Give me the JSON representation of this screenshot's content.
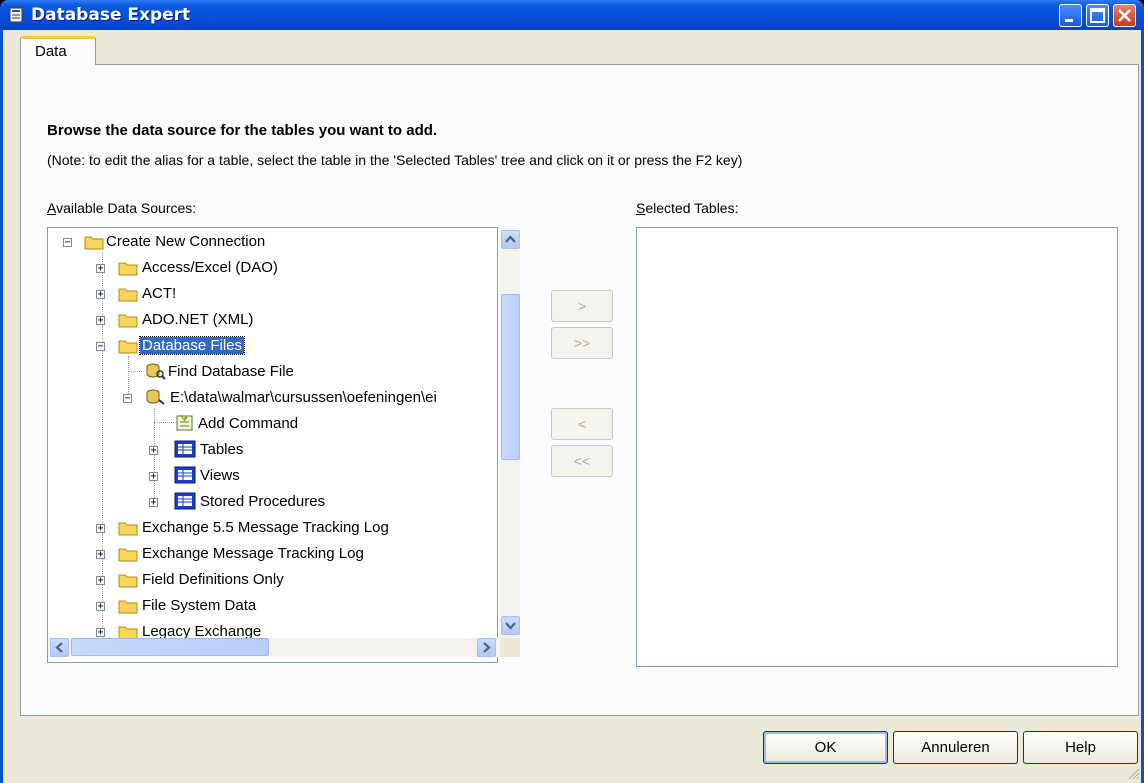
{
  "window": {
    "title": "Database Expert"
  },
  "tabs": [
    {
      "label": "Data",
      "active": true
    }
  ],
  "content": {
    "heading": "Browse the data source for the tables you want to add.",
    "note": "(Note: to edit the alias for a table, select the table in the 'Selected Tables' tree and click on it or press the F2 key)",
    "available_label_underlined": "A",
    "available_label_rest": "vailable Data Sources:",
    "selected_label_underlined": "S",
    "selected_label_rest": "elected Tables:"
  },
  "tree": {
    "items": [
      {
        "label": "Create New Connection",
        "icon": "folder-icon",
        "expanded": true
      },
      {
        "label": "Access/Excel (DAO)",
        "icon": "folder-icon",
        "expanded": false
      },
      {
        "label": "ACT!",
        "icon": "folder-icon",
        "expanded": false
      },
      {
        "label": "ADO.NET (XML)",
        "icon": "folder-icon",
        "expanded": false
      },
      {
        "label": "Database Files",
        "icon": "folder-icon",
        "expanded": true,
        "selected": true
      },
      {
        "label": "Find Database File",
        "icon": "find-database-icon"
      },
      {
        "label": "E:\\data\\walmar\\cursussen\\oefeningen\\ei",
        "icon": "database-connection-icon",
        "expanded": true
      },
      {
        "label": "Add Command",
        "icon": "add-command-icon"
      },
      {
        "label": "Tables",
        "icon": "table-icon",
        "expanded": false
      },
      {
        "label": "Views",
        "icon": "table-icon",
        "expanded": false
      },
      {
        "label": "Stored Procedures",
        "icon": "table-icon",
        "expanded": false
      },
      {
        "label": "Exchange 5.5 Message Tracking Log",
        "icon": "folder-icon",
        "expanded": false
      },
      {
        "label": "Exchange Message Tracking Log",
        "icon": "folder-icon",
        "expanded": false
      },
      {
        "label": "Field Definitions Only",
        "icon": "folder-icon",
        "expanded": false
      },
      {
        "label": "File System Data",
        "icon": "folder-icon",
        "expanded": false
      },
      {
        "label": "Legacy Exchange",
        "icon": "folder-icon",
        "expanded": false
      }
    ]
  },
  "move_buttons": {
    "add": ">",
    "add_all": ">>",
    "remove": "<",
    "remove_all": "<<"
  },
  "dialog_buttons": {
    "ok": "OK",
    "cancel": "Annuleren",
    "help": "Help"
  },
  "colors": {
    "titlebar": "#0650d9",
    "selection": "#316ac5",
    "tab_accent": "#ffc83c",
    "dialog_bg": "#ece9d8"
  }
}
